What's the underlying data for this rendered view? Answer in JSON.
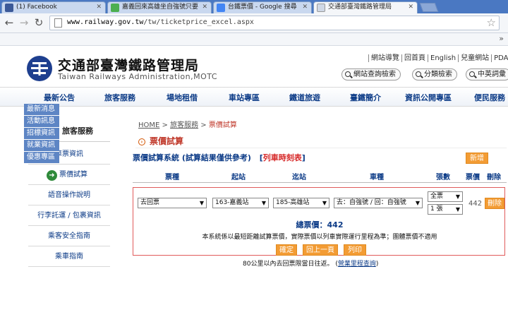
{
  "browser": {
    "tabs": [
      {
        "label": "(1) Facebook",
        "icon": "facebook-icon",
        "color": "#3b5998"
      },
      {
        "label": "嘉義回來高雄坐自強號只要",
        "icon": "ptt-icon",
        "color": "#4caf50"
      },
      {
        "label": "台鐵票價 - Google 搜尋",
        "icon": "google-icon",
        "color": "#4285f4"
      },
      {
        "label": "交通部臺灣鐵路管理局",
        "icon": "page-icon",
        "color": "#cfd8e6"
      }
    ],
    "url_host": "www.railway.gov.tw",
    "url_path": "/tw/ticketprice_excel.aspx",
    "bookmarks_more": "»"
  },
  "site": {
    "title_zh": "交通部臺灣鐵路管理局",
    "title_en": "Taiwan Railways Administration,MOTC",
    "top_links": [
      "網站導覽",
      "回首頁",
      "English",
      "兒童網站",
      "PDA"
    ],
    "search_buttons": [
      "網站查詢檢索",
      "分類檢索",
      "中英詞彙"
    ],
    "main_nav": [
      "最新公告",
      "旅客服務",
      "場地租借",
      "車站專區",
      "鐵道旅遊",
      "臺鐵簡介",
      "資訊公開專區",
      "便民服務"
    ],
    "submenu": [
      "最新消息",
      "活動訊息",
      "招標資訊",
      "就業資訊",
      "優惠專區"
    ],
    "sidebar": {
      "title": "旅客服務",
      "items": [
        "車票資訊",
        "票價試算",
        "語音操作說明",
        "行李託運 / 包裹資訊",
        "乘客安全指南",
        "乘車指南"
      ],
      "current_index": 1
    }
  },
  "content": {
    "breadcrumb": {
      "home": "HOME",
      "sep": " > ",
      "mid": "旅客服務",
      "current": "票價試算"
    },
    "section_title": "票價試算",
    "sys_title": "票價試算系統 (試算結果僅供參考)",
    "timetable_link": "列車時刻表",
    "add_button": "新增",
    "columns": [
      "票種",
      "起站",
      "迄站",
      "車種",
      "張數",
      "票價",
      "刪除"
    ],
    "row": {
      "ticket_type": "去回票",
      "from_station": "163-嘉義站",
      "to_station": "185-高雄站",
      "train_type": "去：自強號 / 回：自強號",
      "fare_type": "全票",
      "count": "1 張",
      "price": "442",
      "delete_label": "刪除"
    },
    "total_label": "總票價：442",
    "note": "本系統係以最短距離試算票價，實際票價以列車實際運行里程為準；團體票價不適用",
    "buttons": {
      "confirm": "確定",
      "back": "回上一頁",
      "print": "列印"
    },
    "bottom_note": "80公里以內去回票限當日往返。",
    "bottom_link": "營業里程查詢"
  },
  "colors": {
    "accent_orange": "#f39c34",
    "nav_blue": "#0c3b87",
    "alert_red": "#d62828"
  }
}
